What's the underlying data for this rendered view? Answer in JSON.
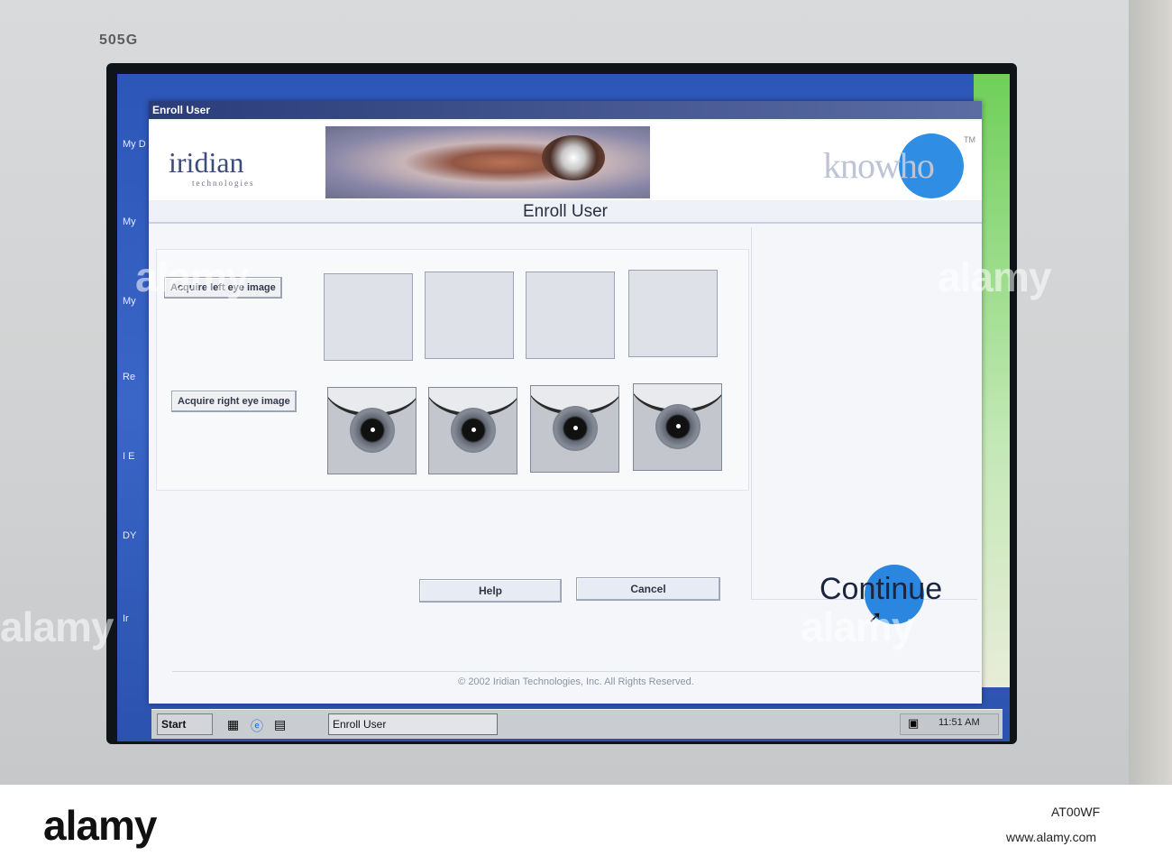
{
  "monitor": {
    "model": "505G"
  },
  "window": {
    "title": "Enroll User"
  },
  "banner": {
    "left_logo": "iridian",
    "left_logo_sub": "technologies",
    "right_logo": "knowho",
    "right_logo_tm": "TM"
  },
  "page": {
    "heading": "Enroll User"
  },
  "acquire": {
    "left_label": "Acquire left eye image",
    "right_label": "Acquire right eye image",
    "left_slots_filled": 0,
    "right_slots_filled": 4
  },
  "buttons": {
    "help": "Help",
    "cancel": "Cancel",
    "continue": "Continue"
  },
  "footer": {
    "copyright": "© 2002 Iridian Technologies, Inc. All Rights Reserved."
  },
  "taskbar": {
    "start": "Start",
    "task": "Enroll User",
    "clock": "11:51 AM"
  },
  "desktop_icons": [
    "My D",
    "My",
    "My",
    "Re",
    "I E",
    "DY",
    "Ir"
  ],
  "watermark": "alamy",
  "stock": {
    "id": "AT00WF",
    "url": "www.alamy.com"
  },
  "colors": {
    "accent": "#2f8de4",
    "desktop": "#2c56b8",
    "titlebar": "#2a3c7a"
  }
}
